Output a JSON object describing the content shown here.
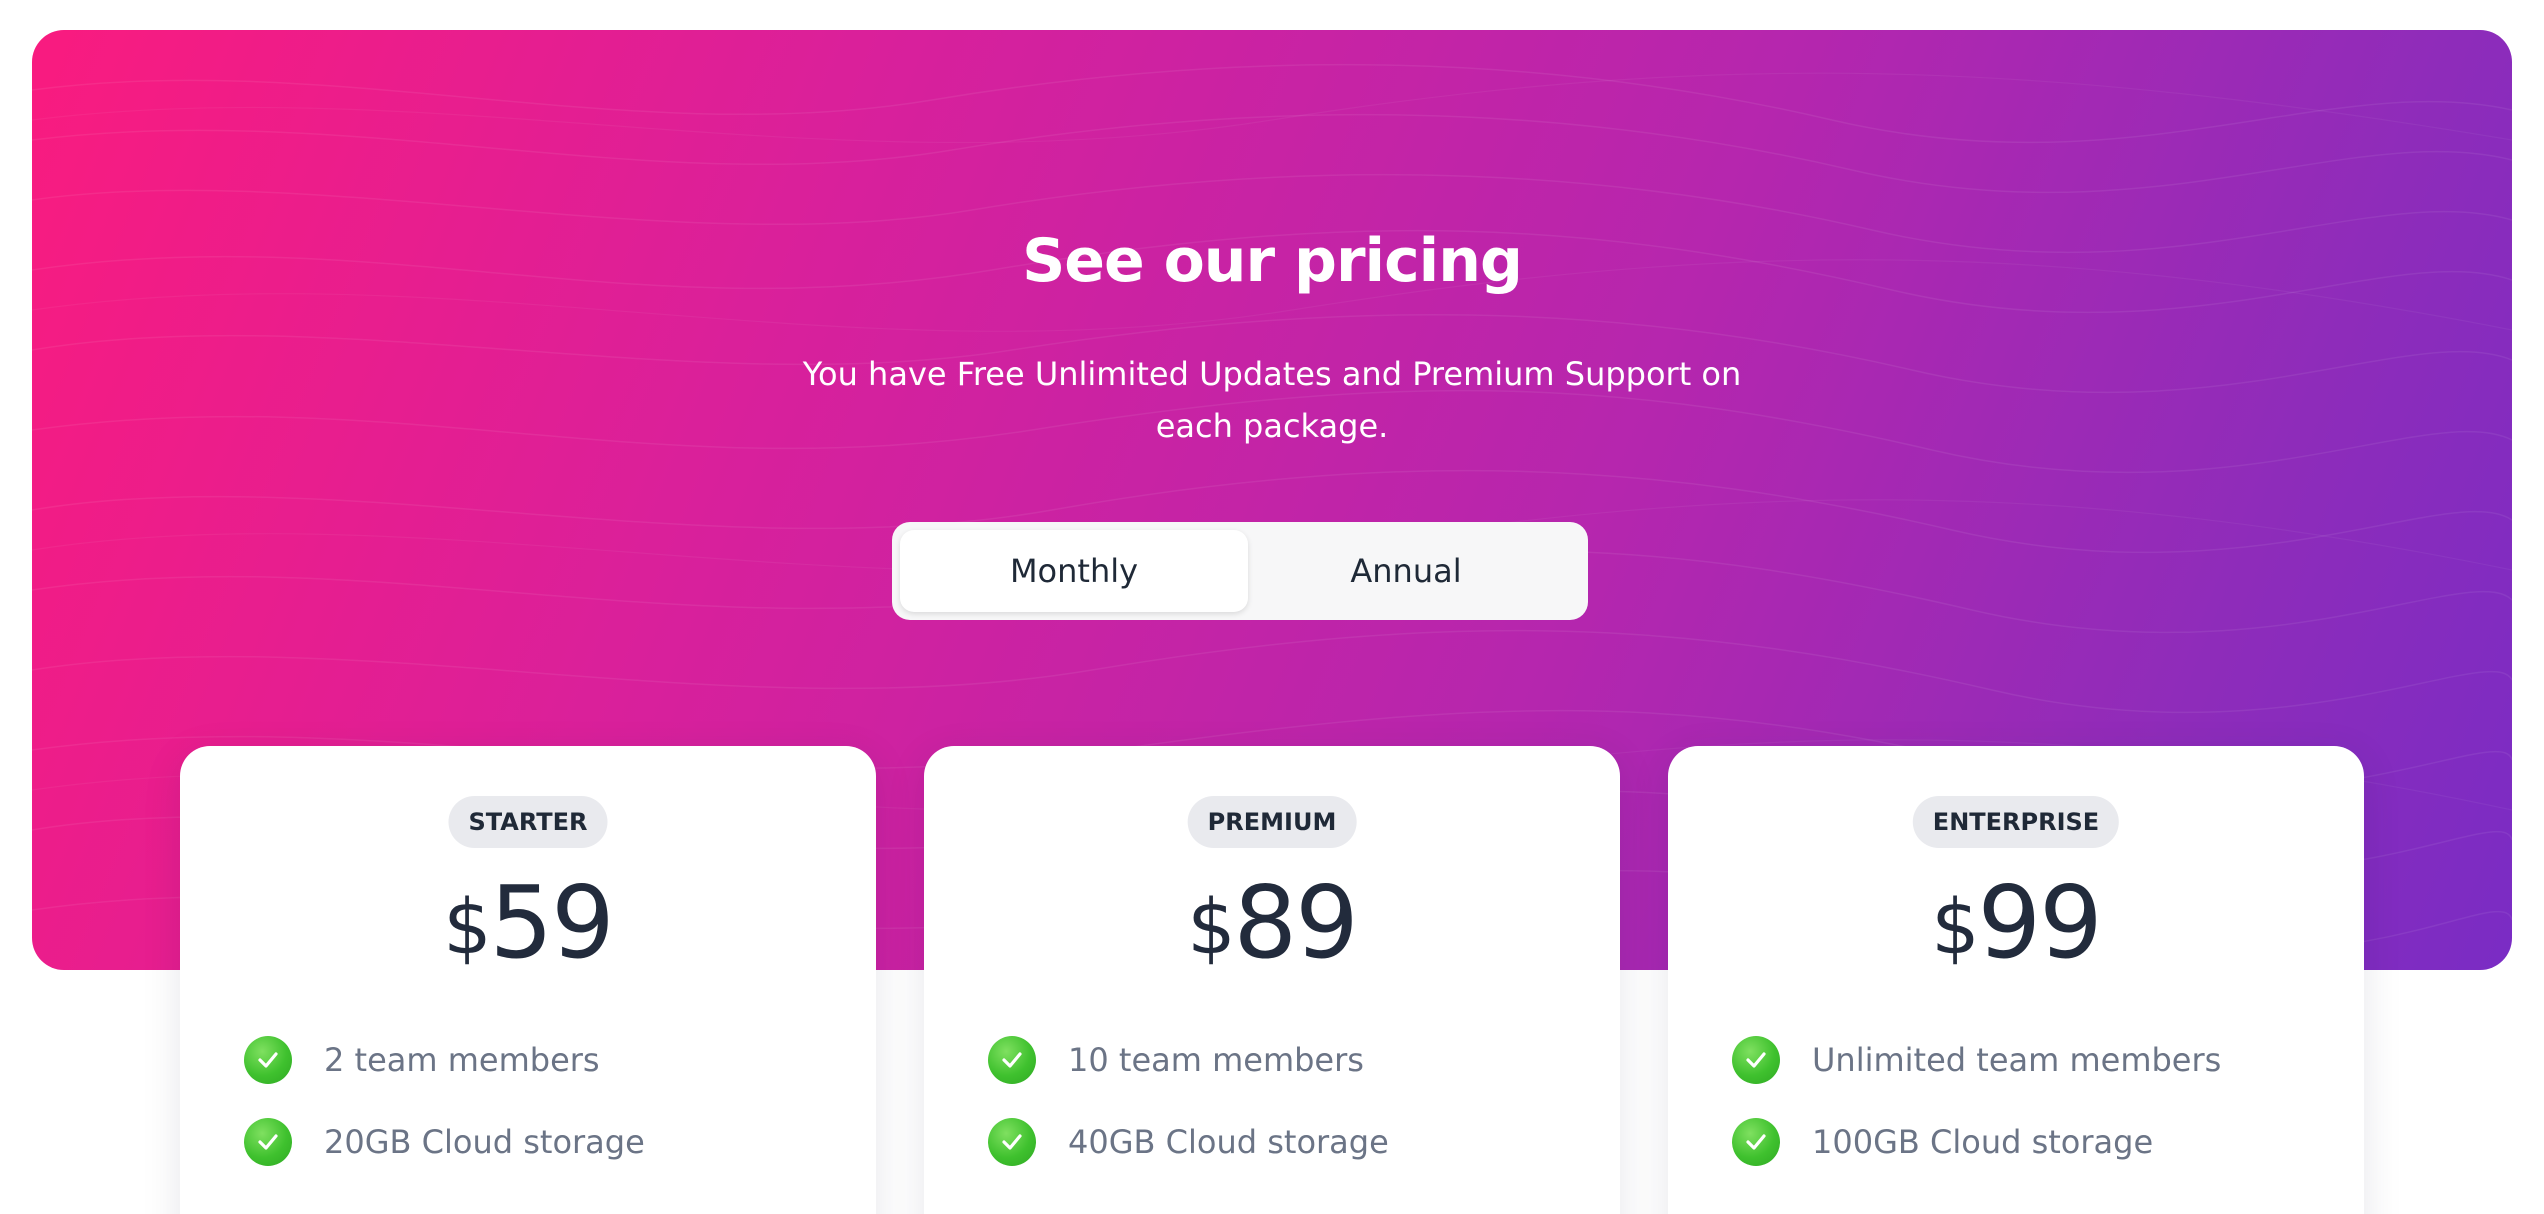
{
  "hero": {
    "title": "See our pricing",
    "subtitle": "You have Free Unlimited Updates and Premium Support on each package.",
    "gradient_start": "#f91b7f",
    "gradient_end": "#7a2cc4"
  },
  "billing_toggle": {
    "options": [
      "Monthly",
      "Annual"
    ],
    "selected": "Monthly"
  },
  "plans": [
    {
      "badge": "STARTER",
      "currency": "$",
      "amount": "59",
      "features": [
        "2 team members",
        "20GB Cloud storage"
      ]
    },
    {
      "badge": "PREMIUM",
      "currency": "$",
      "amount": "89",
      "features": [
        "10 team members",
        "40GB Cloud storage"
      ]
    },
    {
      "badge": "ENTERPRISE",
      "currency": "$",
      "amount": "99",
      "features": [
        "Unlimited team members",
        "100GB Cloud storage"
      ]
    }
  ],
  "icons": {
    "feature_check": "check-circle-icon",
    "check_color": "#3fc12e"
  }
}
